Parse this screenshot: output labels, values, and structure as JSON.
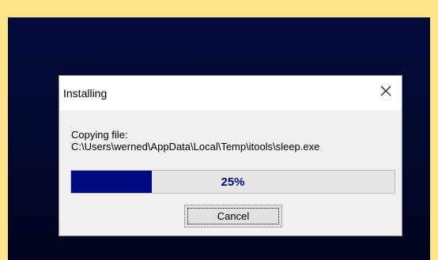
{
  "dialog": {
    "title": "Installing",
    "message_line1": "Copying file:",
    "message_line2": "C:\\Users\\werned\\AppData\\Local\\Temp\\itools\\sleep.exe",
    "progress_percent": 25,
    "progress_label": "25%",
    "cancel_label": "Cancel",
    "close_icon": "close-icon"
  },
  "colors": {
    "page_background": "#fde48a",
    "desktop_background": "#03082e",
    "progress_fill": "#000a80"
  }
}
